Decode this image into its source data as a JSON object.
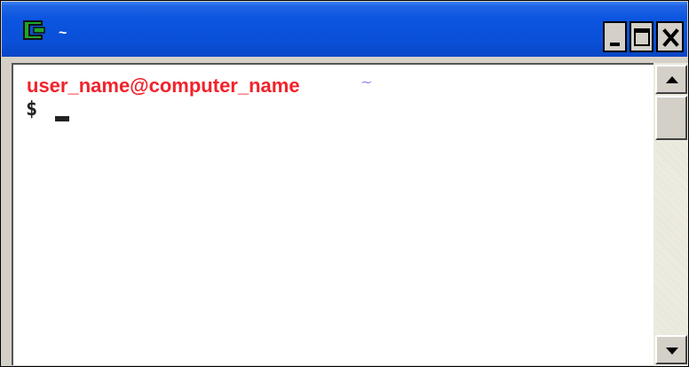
{
  "window": {
    "title": "~",
    "controls": {
      "minimize": "minimize",
      "maximize": "maximize",
      "close": "close"
    }
  },
  "terminal": {
    "user_host": "user_name@computer_name",
    "cwd": "~",
    "prompt_symbol": "$"
  },
  "colors": {
    "titlebar": "#0a50d8",
    "user_host": "#f2222a",
    "cwd": "#8d8cf0",
    "background": "#ffffff"
  },
  "icons": {
    "app": "cygwin-icon",
    "minimize": "minimize-icon",
    "maximize": "maximize-icon",
    "close": "close-icon",
    "scroll_up": "arrow-up-icon",
    "scroll_down": "arrow-down-icon"
  }
}
